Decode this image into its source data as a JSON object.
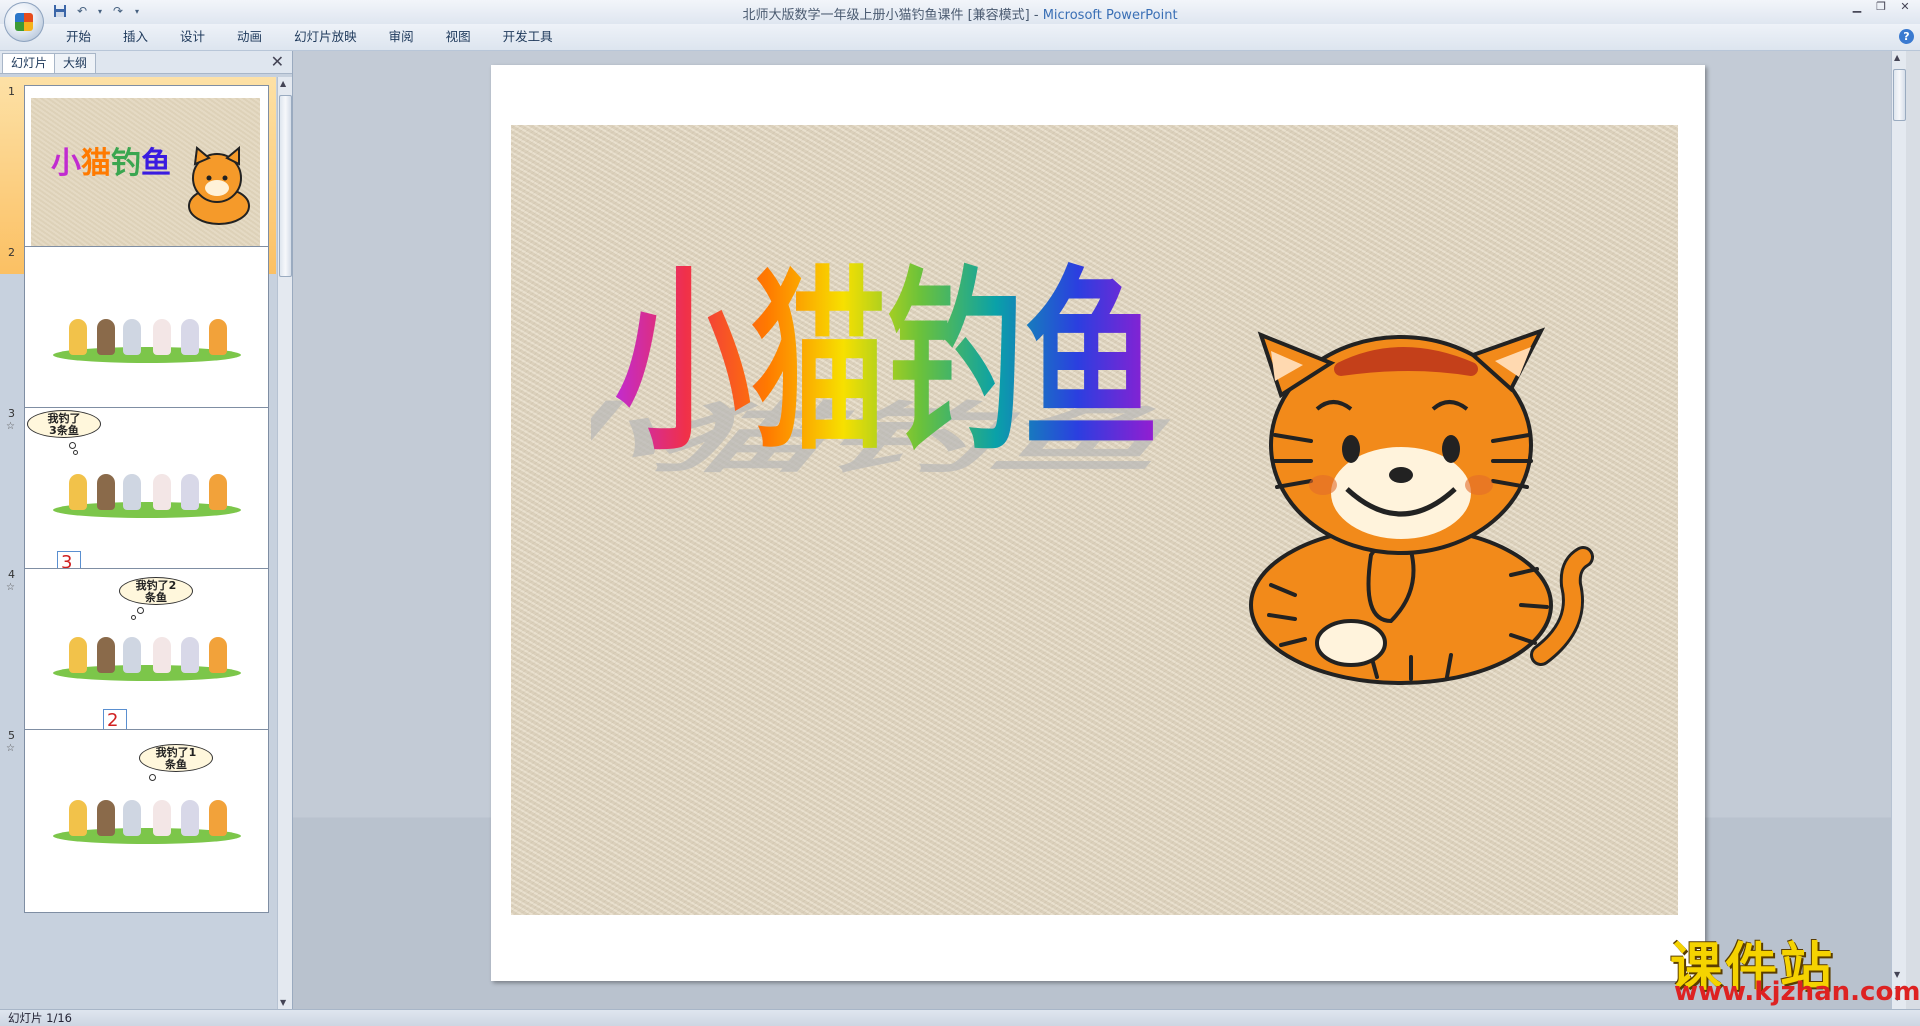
{
  "window": {
    "title": "北师大版数学一年级上册小猫钓鱼课件 [兼容模式]",
    "app_name": "Microsoft PowerPoint",
    "separator": " - "
  },
  "ribbon": {
    "tabs": [
      {
        "label": "开始"
      },
      {
        "label": "插入"
      },
      {
        "label": "设计"
      },
      {
        "label": "动画"
      },
      {
        "label": "幻灯片放映"
      },
      {
        "label": "审阅"
      },
      {
        "label": "视图"
      },
      {
        "label": "开发工具"
      }
    ]
  },
  "left_pane": {
    "tabs": [
      {
        "label": "幻灯片"
      },
      {
        "label": "大纲"
      }
    ],
    "close_glyph": "✕",
    "slides": [
      {
        "number": "1",
        "selected": true
      },
      {
        "number": "2"
      },
      {
        "number": "3",
        "bubble": "我钓了3条鱼",
        "bubble_l1": "我钓了",
        "bubble_l2": "3条鱼",
        "digit": "3"
      },
      {
        "number": "4",
        "bubble": "我钓了2条鱼",
        "bubble_l1": "我钓了2",
        "bubble_l2": "条鱼",
        "digit": "2"
      },
      {
        "number": "5",
        "bubble": "我钓了1条鱼",
        "bubble_l1": "我钓了1",
        "bubble_l2": "条鱼"
      }
    ]
  },
  "slide": {
    "title_chars": [
      "小",
      "猫",
      "钓",
      "鱼"
    ],
    "title_colors": [
      "#c12bd0",
      "#ff6a00",
      "#7cc200",
      "#3a1be0"
    ]
  },
  "watermark": {
    "title": "课件站",
    "url": "www.kjzhan.com"
  },
  "status_bar": {
    "slide_indicator": "幻灯片 1/16"
  },
  "icons": {
    "save": "save-icon",
    "undo": "undo-icon",
    "redo": "redo-icon",
    "help": "help-icon"
  }
}
